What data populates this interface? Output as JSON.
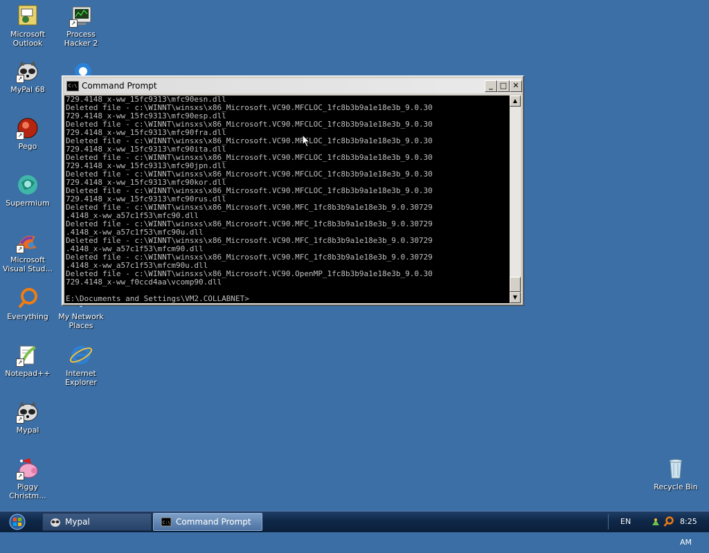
{
  "desktop": {
    "icons": [
      {
        "label": "Microsoft\nOutlook",
        "icon": "outlook-icon"
      },
      {
        "label": "Process\nHacker 2",
        "icon": "process-hacker-icon"
      },
      {
        "label": "MyPal 68",
        "icon": "raccoon-icon"
      },
      {
        "label": "Pego",
        "icon": "pego-icon"
      },
      {
        "label": "Supermium",
        "icon": "supermium-icon"
      },
      {
        "label": "Microsoft\nVisual Stud...",
        "icon": "visual-studio-icon"
      },
      {
        "label": "Everything",
        "icon": "everything-icon"
      },
      {
        "label": "My Network\nPlaces",
        "icon": "network-places-icon"
      },
      {
        "label": "Notepad++",
        "icon": "notepadpp-icon"
      },
      {
        "label": "Internet\nExplorer",
        "icon": "internet-explorer-icon"
      },
      {
        "label": "Mypal",
        "icon": "raccoon-icon"
      },
      {
        "label": "Piggy\nChristm...",
        "icon": "piggy-icon"
      },
      {
        "label": "Recycle Bin",
        "icon": "recycle-bin-icon"
      }
    ]
  },
  "window": {
    "title": "Command Prompt",
    "minimize_glyph": "_",
    "maximize_glyph": "□",
    "close_glyph": "✕",
    "console_lines": [
      "729.4148_x-ww_15fc9313\\mfc90esn.dll",
      "Deleted file - c:\\WINNT\\winsxs\\x86_Microsoft.VC90.MFCLOC_1fc8b3b9a1e18e3b_9.0.30",
      "729.4148_x-ww_15fc9313\\mfc90esp.dll",
      "Deleted file - c:\\WINNT\\winsxs\\x86_Microsoft.VC90.MFCLOC_1fc8b3b9a1e18e3b_9.0.30",
      "729.4148_x-ww_15fc9313\\mfc90fra.dll",
      "Deleted file - c:\\WINNT\\winsxs\\x86_Microsoft.VC90.MFCLOC_1fc8b3b9a1e18e3b_9.0.30",
      "729.4148_x-ww_15fc9313\\mfc90ita.dll",
      "Deleted file - c:\\WINNT\\winsxs\\x86_Microsoft.VC90.MFCLOC_1fc8b3b9a1e18e3b_9.0.30",
      "729.4148_x-ww_15fc9313\\mfc90jpn.dll",
      "Deleted file - c:\\WINNT\\winsxs\\x86_Microsoft.VC90.MFCLOC_1fc8b3b9a1e18e3b_9.0.30",
      "729.4148_x-ww_15fc9313\\mfc90kor.dll",
      "Deleted file - c:\\WINNT\\winsxs\\x86_Microsoft.VC90.MFCLOC_1fc8b3b9a1e18e3b_9.0.30",
      "729.4148_x-ww_15fc9313\\mfc90rus.dll",
      "Deleted file - c:\\WINNT\\winsxs\\x86_Microsoft.VC90.MFC_1fc8b3b9a1e18e3b_9.0.30729",
      ".4148_x-ww_a57c1f53\\mfc90.dll",
      "Deleted file - c:\\WINNT\\winsxs\\x86_Microsoft.VC90.MFC_1fc8b3b9a1e18e3b_9.0.30729",
      ".4148_x-ww_a57c1f53\\mfc90u.dll",
      "Deleted file - c:\\WINNT\\winsxs\\x86_Microsoft.VC90.MFC_1fc8b3b9a1e18e3b_9.0.30729",
      ".4148_x-ww_a57c1f53\\mfcm90.dll",
      "Deleted file - c:\\WINNT\\winsxs\\x86_Microsoft.VC90.MFC_1fc8b3b9a1e18e3b_9.0.30729",
      ".4148_x-ww_a57c1f53\\mfcm90u.dll",
      "Deleted file - c:\\WINNT\\winsxs\\x86_Microsoft.VC90.OpenMP_1fc8b3b9a1e18e3b_9.0.30",
      "729.4148_x-ww_f0ccd4aa\\vcomp90.dll",
      "",
      "E:\\Documents and Settings\\VM2.COLLABNET>"
    ],
    "scroll_up_glyph": "▲",
    "scroll_down_glyph": "▼"
  },
  "taskbar": {
    "buttons": [
      {
        "label": "Mypal",
        "icon": "raccoon-icon",
        "active": false
      },
      {
        "label": "Command Prompt",
        "icon": "cmd-icon",
        "active": true
      }
    ],
    "language": "EN",
    "clock": "8:25 AM"
  },
  "colors": {
    "desktop_bg": "#3b6fa6",
    "console_bg": "#000000",
    "console_text": "#c0c0c0"
  }
}
